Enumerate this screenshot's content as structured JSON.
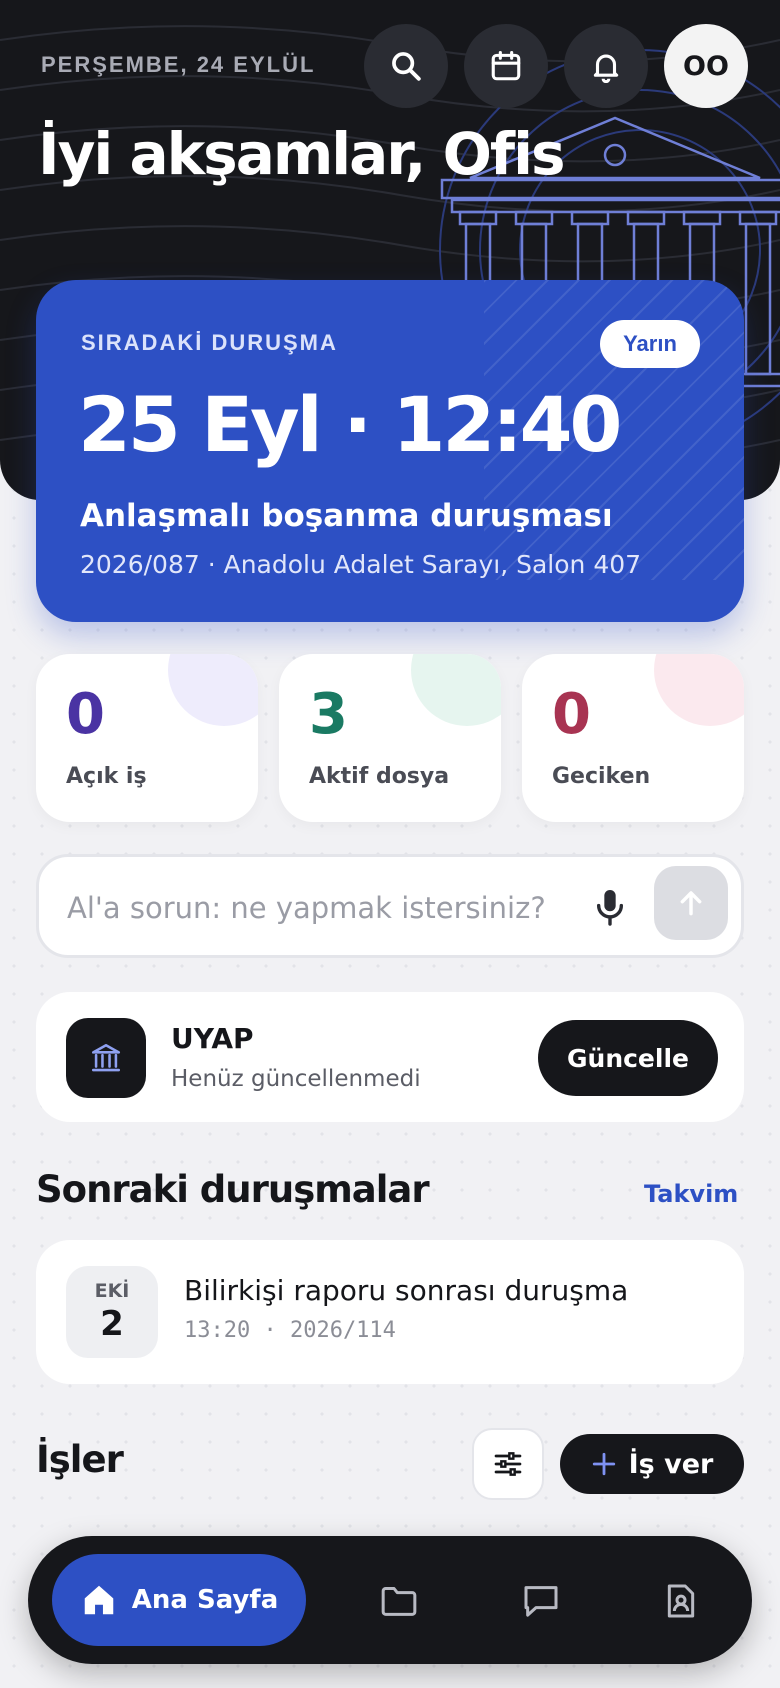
{
  "header": {
    "date": "PERŞEMBE, 24 EYLÜL",
    "greeting": "İyi akşamlar, Ofis",
    "avatar_initials": "OO",
    "icons": [
      "search-icon",
      "calendar-icon",
      "bell-icon"
    ]
  },
  "next_hearing": {
    "label": "SIRADAKİ DURUŞMA",
    "badge": "Yarın",
    "datetime": "25 Eyl · 12:40",
    "title": "Anlaşmalı boşanma duruşması",
    "details": "2026/087 · Anadolu Adalet Sarayı, Salon 407"
  },
  "stats": [
    {
      "value": "0",
      "label": "Açık iş",
      "color": "#4a33a3",
      "blob": "#eeecfc"
    },
    {
      "value": "3",
      "label": "Aktif dosya",
      "color": "#1a7a63",
      "blob": "#e6f5ef"
    },
    {
      "value": "0",
      "label": "Geciken",
      "color": "#a83452",
      "blob": "#fbe9ee"
    }
  ],
  "ask": {
    "placeholder": "Al'a sorun: ne yapmak istersiniz?"
  },
  "uyap": {
    "title": "UYAP",
    "status": "Henüz güncellenmedi",
    "button": "Güncelle"
  },
  "upcoming": {
    "title": "Sonraki duruşmalar",
    "link": "Takvim",
    "items": [
      {
        "month": "EKİ",
        "day": "2",
        "title": "Bilirkişi raporu sonrası duruşma",
        "meta": "13:20 · 2026/114"
      }
    ]
  },
  "tasks": {
    "title": "İşler",
    "add_button": "İş ver"
  },
  "nav": {
    "active_label": "Ana Sayfa",
    "items": [
      "home-icon",
      "folder-icon",
      "chat-icon",
      "profile-document-icon"
    ]
  },
  "colors": {
    "dark": "#16171b",
    "accent": "#2d50c4",
    "background": "#f1f1f4"
  }
}
